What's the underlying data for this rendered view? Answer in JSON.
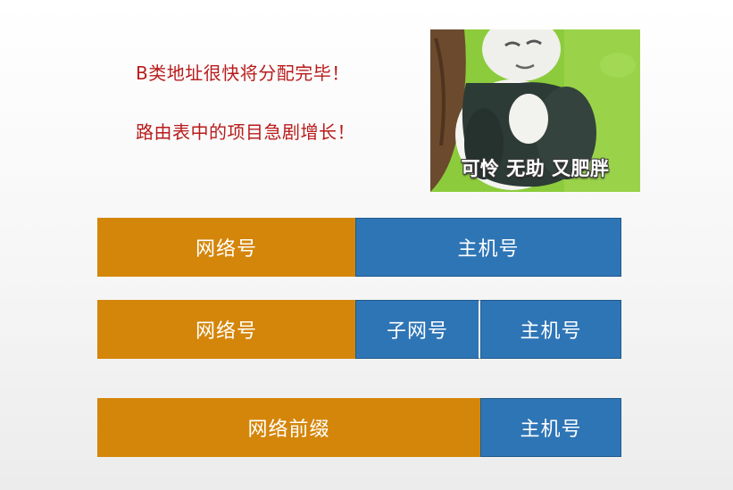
{
  "text": {
    "line1": "B类地址很快将分配完毕！",
    "line2": "路由表中的项目急剧增长！"
  },
  "meme": {
    "caption": "可怜 无助 又肥胖"
  },
  "bar1": {
    "network": "网络号",
    "host": "主机号"
  },
  "bar2": {
    "network": "网络号",
    "subnet": "子网号",
    "host": "主机号"
  },
  "bar3": {
    "prefix": "网络前缀",
    "host": "主机号"
  },
  "colors": {
    "text_red": "#b81c1c",
    "orange": "#d4860a",
    "blue": "#2e75b6",
    "meme_green": "#8ccc3c"
  }
}
